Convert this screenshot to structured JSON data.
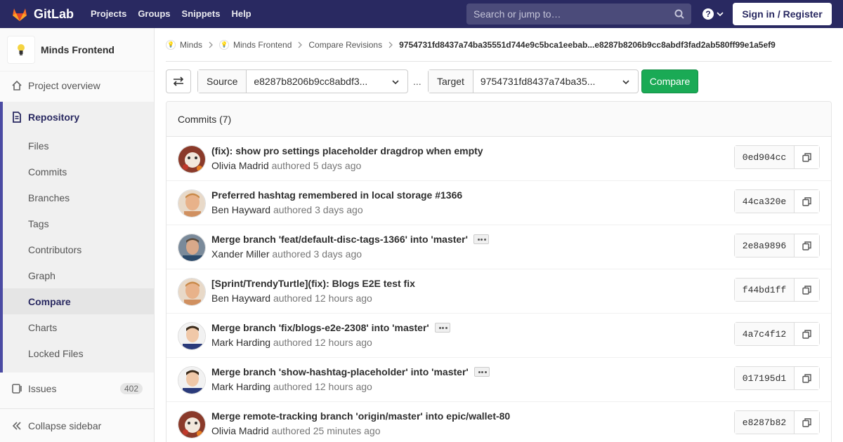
{
  "navbar": {
    "brand": "GitLab",
    "links": [
      "Projects",
      "Groups",
      "Snippets",
      "Help"
    ],
    "search_placeholder": "Search or jump to…",
    "signin": "Sign in / Register",
    "help_icon_text": "?",
    "brand_color": "#292961"
  },
  "sidebar": {
    "project_name": "Minds Frontend",
    "overview": "Project overview",
    "repository": "Repository",
    "items": [
      "Files",
      "Commits",
      "Branches",
      "Tags",
      "Contributors",
      "Graph",
      "Compare",
      "Charts",
      "Locked Files"
    ],
    "active_item": "Compare",
    "issues": "Issues",
    "issues_count": "402",
    "collapse": "Collapse sidebar"
  },
  "breadcrumb": {
    "items": [
      "Minds",
      "Minds Frontend",
      "Compare Revisions"
    ],
    "current": "9754731fd8437a74ba35551d744e9c5bca1eebab...e8287b8206b9cc8abdf3fad2ab580ff99e1a5ef9"
  },
  "compare": {
    "source_label": "Source",
    "source_value": "e8287b8206b9cc8abdf3...",
    "separator": "...",
    "target_label": "Target",
    "target_value": "9754731fd8437a74ba35...",
    "button": "Compare"
  },
  "commits": {
    "header": "Commits (7)",
    "authored_word": "authored",
    "rows": [
      {
        "title": "(fix): show pro settings placeholder dragdrop when empty",
        "author": "Olivia Madrid",
        "time": "5 days ago",
        "sha": "0ed904cc",
        "has_more": false,
        "avatar": "cat"
      },
      {
        "title": "Preferred hashtag remembered in local storage #1366",
        "author": "Ben Hayward",
        "time": "3 days ago",
        "sha": "44ca320e",
        "has_more": false,
        "avatar": "ben"
      },
      {
        "title": "Merge branch 'feat/default-disc-tags-1366' into 'master'",
        "author": "Xander Miller",
        "time": "3 days ago",
        "sha": "2e8a9896",
        "has_more": true,
        "avatar": "xander"
      },
      {
        "title": "[Sprint/TrendyTurtle](fix): Blogs E2E test fix",
        "author": "Ben Hayward",
        "time": "12 hours ago",
        "sha": "f44bd1ff",
        "has_more": false,
        "avatar": "ben"
      },
      {
        "title": "Merge branch 'fix/blogs-e2e-2308' into 'master'",
        "author": "Mark Harding",
        "time": "12 hours ago",
        "sha": "4a7c4f12",
        "has_more": true,
        "avatar": "mark"
      },
      {
        "title": "Merge branch 'show-hashtag-placeholder' into 'master'",
        "author": "Mark Harding",
        "time": "12 hours ago",
        "sha": "017195d1",
        "has_more": true,
        "avatar": "mark"
      },
      {
        "title": "Merge remote-tracking branch 'origin/master' into epic/wallet-80",
        "author": "Olivia Madrid",
        "time": "25 minutes ago",
        "sha": "e8287b82",
        "has_more": false,
        "avatar": "cat"
      }
    ]
  },
  "colors": {
    "accent": "#4b4ba3",
    "compare_button": "#1aaa55"
  },
  "icons": {
    "logo": "gitlab-tanuki-icon",
    "search": "search-icon",
    "help": "question-circle-icon",
    "overview": "home-icon",
    "repository": "document-icon",
    "issues": "issues-icon",
    "collapse": "double-chevron-left-icon",
    "swap": "swap-arrows-icon",
    "copy": "copy-icon",
    "more": "ellipsis-icon"
  }
}
